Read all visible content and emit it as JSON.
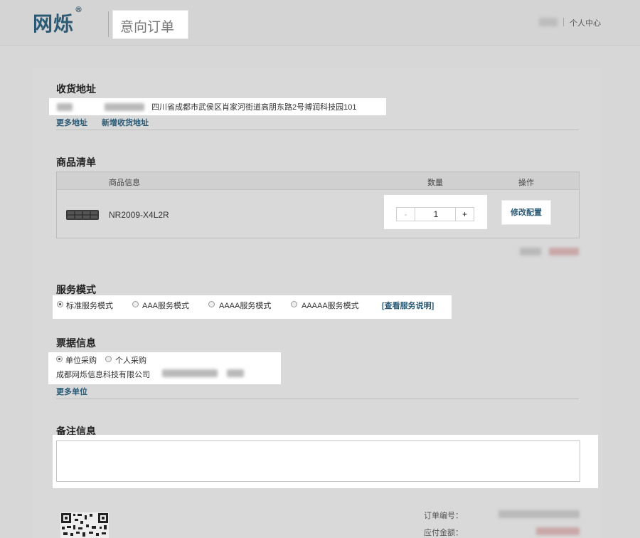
{
  "header": {
    "logo": "网烁",
    "logo_mark": "®",
    "page_title": "意向订单",
    "personal_center": "个人中心"
  },
  "address": {
    "heading": "收货地址",
    "full_address": "四川省成都市武侯区肖家河街道高朋东路2号搏润科技园101",
    "more_label": "更多地址",
    "add_label": "新增收货地址"
  },
  "products": {
    "heading": "商品清单",
    "columns": [
      "商品信息",
      "数量",
      "操作"
    ],
    "rows": [
      {
        "name": "NR2009-X4L2R",
        "quantity": "1",
        "action": "修改配置"
      }
    ],
    "stepper_minus": "-",
    "stepper_plus": "+"
  },
  "service": {
    "heading": "服务模式",
    "options": [
      {
        "label": "标准服务模式",
        "selected": true
      },
      {
        "label": "AAA服务模式",
        "selected": false
      },
      {
        "label": "AAAA服务模式",
        "selected": false
      },
      {
        "label": "AAAAA服务模式",
        "selected": false
      }
    ],
    "info_link": "[查看服务说明]"
  },
  "invoice": {
    "heading": "票据信息",
    "options": [
      {
        "label": "单位采购",
        "selected": true
      },
      {
        "label": "个人采购",
        "selected": false
      }
    ],
    "company": "成都网烁信息科技有限公司",
    "more_label": "更多单位"
  },
  "notes": {
    "heading": "备注信息",
    "value": ""
  },
  "order_meta": {
    "order_no_label": "订单编号：",
    "amount_label": "应付金额："
  },
  "colors": {
    "brand": "#2c5a74",
    "link": "#2b5a75",
    "page_bg": "#d7d7d7",
    "highlight": "#ffffff"
  }
}
